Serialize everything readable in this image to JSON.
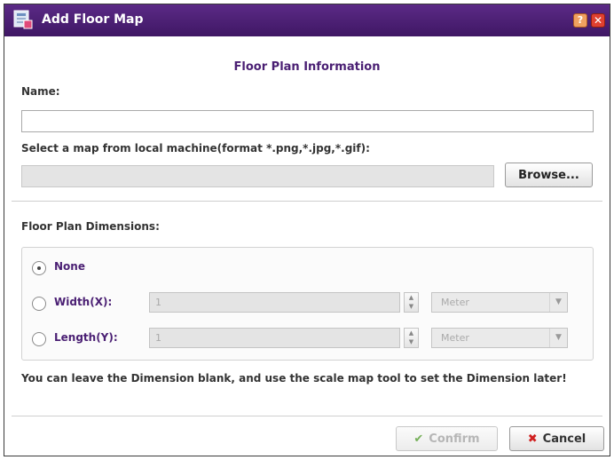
{
  "window": {
    "title": "Add Floor Map",
    "help_glyph": "?",
    "close_glyph": "✕"
  },
  "form": {
    "section_title": "Floor Plan Information",
    "name_label": "Name:",
    "name_value": "",
    "map_label": "Select a map from local machine(format *.png,*.jpg,*.gif):",
    "map_value": "",
    "browse_label": "Browse...",
    "dimensions_label": "Floor Plan Dimensions:"
  },
  "dimensions": {
    "none_label": "None",
    "none_checked": true,
    "width_label": "Width(X):",
    "width_value": "1",
    "width_unit": "Meter",
    "length_label": "Length(Y):",
    "length_value": "1",
    "length_unit": "Meter"
  },
  "note": "You can leave the Dimension blank, and use the scale map tool to set the Dimension later!",
  "footer": {
    "confirm_label": "Confirm",
    "confirm_icon": "✔",
    "cancel_label": "Cancel",
    "cancel_icon": "✖"
  },
  "colors": {
    "titlebar": "#4a1f73",
    "accent_text": "#4a1f73"
  }
}
